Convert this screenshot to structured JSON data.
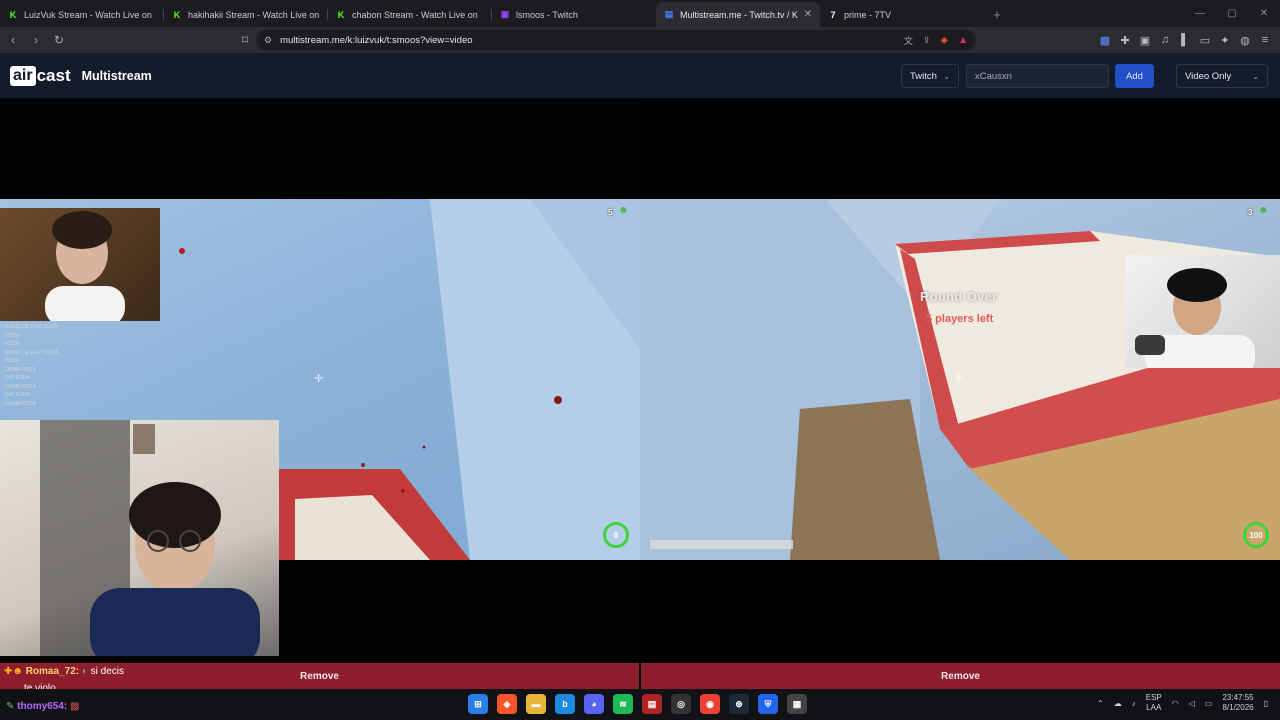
{
  "browser": {
    "tabs": [
      {
        "label": "LuizVuk Stream - Watch Live on",
        "icon": "kick-icon",
        "color": "#53fc18"
      },
      {
        "label": "hakihakii Stream - Watch Live on",
        "icon": "kick-icon",
        "color": "#53fc18"
      },
      {
        "label": "chabon Stream - Watch Live on",
        "icon": "kick-icon",
        "color": "#53fc18"
      },
      {
        "label": "lsmoos - Twitch",
        "icon": "twitch-icon",
        "color": "#9146ff"
      },
      {
        "label": "Multistream.me - Twitch.tv / K",
        "icon": "multistream-icon",
        "color": "#4a7dff",
        "active": true
      },
      {
        "label": "prime - 7TV",
        "icon": "7tv-icon",
        "color": "#ffffff"
      }
    ],
    "url": "multistream.me/k:luizvuk/t:smoos?view=video"
  },
  "site": {
    "logo_a": "air",
    "logo_b": "cast",
    "brand": "Multistream",
    "platform": "Twitch",
    "channel_value": "xCausxn",
    "add_label": "Add",
    "view_mode": "Video Only",
    "accent": "#2150c7"
  },
  "streams": {
    "left": {
      "players_count": "5",
      "hp": "0",
      "chat_overlay": [
        "RADIO CE | EAT SODA",
        "PIZZA",
        "PIZZA",
        "RADIO CE | EAT SODA",
        "PIZZA",
        "DRINK PIZZA",
        "EAT SODA",
        "DRINK PIZZA",
        "EAT SODA",
        "DRINK PIZZA"
      ]
    },
    "right": {
      "players_count": "3",
      "round_title": "Round Over",
      "players_left": "5 players left",
      "hp": "100"
    }
  },
  "remove_left": "Remove",
  "remove_right": "Remove",
  "chat": [
    {
      "user": "Romaa_72:",
      "text": "si decis",
      "user_color": "#f5d76e"
    },
    {
      "user": "",
      "text": "te violo",
      "user_color": "#ffffff"
    },
    {
      "user": "thomy654:",
      "text": "",
      "user_color": "#b36bff"
    }
  ],
  "taskbar": {
    "lang_top": "ESP",
    "lang_bottom": "LAA",
    "time": "23:47:55",
    "date": "8/1/2026"
  }
}
